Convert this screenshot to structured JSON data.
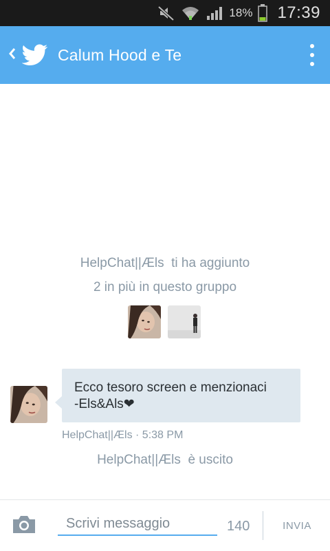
{
  "status_bar": {
    "battery_pct": "18%",
    "time": "17:39",
    "icons": [
      "muted-icon",
      "wifi-icon",
      "signal-icon",
      "battery-icon"
    ]
  },
  "app_bar": {
    "title": "Calum Hood e Te",
    "color": "#55acee",
    "icons": [
      "back-icon",
      "twitter-bird-icon",
      "overflow-menu-icon"
    ]
  },
  "conversation": {
    "added_event": {
      "user": "HelpChat||Æls",
      "line1_suffix": "ti ha aggiunto",
      "line2": "2 in più in questo gruppo"
    },
    "message": {
      "text_line1": "Ecco tesoro screen e menzionaci",
      "text_line2": "-Els&Als❤",
      "sender": "HelpChat||Æls",
      "time": "· 5:38 PM"
    },
    "left_event": {
      "user": "HelpChat||Æls",
      "suffix": "è uscito"
    }
  },
  "compose": {
    "placeholder": "Scrivi messaggio",
    "char_count": "140",
    "send_label": "INVIA",
    "icons": [
      "camera-icon"
    ]
  }
}
